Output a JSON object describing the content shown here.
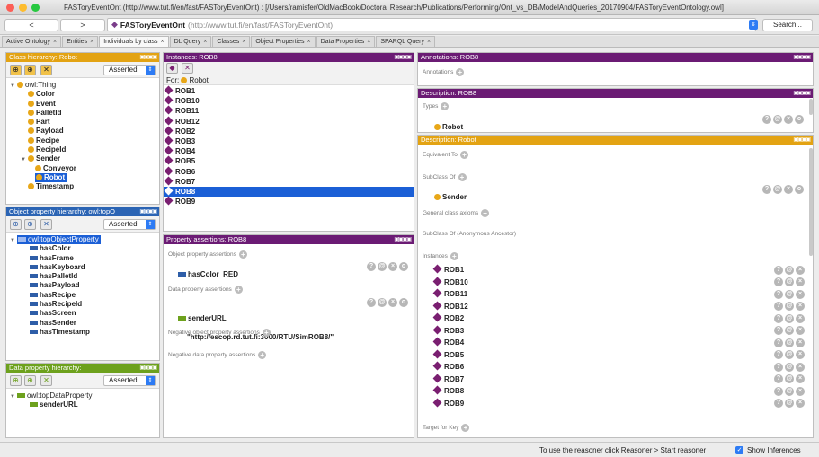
{
  "window": {
    "title": "FASToryEventOnt (http://www.tut.fi/en/fast/FASToryEventOnt) : [/Users/ramisfer/OldMacBook/Doctoral Research/Publications/Performing/Ont_vs_DB/ModelAndQueries_20170904/FASToryEventOntology.owl]"
  },
  "toolbar": {
    "back": "<",
    "forward": ">",
    "ontology_name": "FASToryEventOnt",
    "ontology_uri": "(http://www.tut.fi/en/fast/FASToryEventOnt)",
    "search_label": "Search..."
  },
  "tabs": [
    {
      "label": "Active Ontology"
    },
    {
      "label": "Entities"
    },
    {
      "label": "Individuals by class"
    },
    {
      "label": "DL Query"
    },
    {
      "label": "Classes"
    },
    {
      "label": "Object Properties"
    },
    {
      "label": "Data Properties"
    },
    {
      "label": "SPARQL Query"
    }
  ],
  "class_hierarchy": {
    "title": "Class hierarchy: Robot",
    "mode": "Asserted",
    "root": "owl:Thing",
    "items": [
      "Color",
      "Event",
      "PalletId",
      "Part",
      "Payload",
      "Recipe",
      "RecipeId",
      "Sender",
      "Conveyor",
      "Robot",
      "Timestamp"
    ]
  },
  "object_property_hierarchy": {
    "title": "Object property hierarchy: owl:topO",
    "mode": "Asserted",
    "root": "owl:topObjectProperty",
    "items": [
      "hasColor",
      "hasFrame",
      "hasKeyboard",
      "hasPalletId",
      "hasPayload",
      "hasRecipe",
      "hasRecipeId",
      "hasScreen",
      "hasSender",
      "hasTimestamp"
    ]
  },
  "data_property_hierarchy": {
    "title": "Data property hierarchy:",
    "mode": "Asserted",
    "root": "owl:topDataProperty",
    "items": [
      "senderURL"
    ]
  },
  "instances": {
    "title": "Instances: ROB8",
    "for_label": "For:",
    "for_class": "Robot",
    "items": [
      "ROB1",
      "ROB10",
      "ROB11",
      "ROB12",
      "ROB2",
      "ROB3",
      "ROB4",
      "ROB5",
      "ROB6",
      "ROB7",
      "ROB8",
      "ROB9"
    ],
    "selected": "ROB8"
  },
  "property_assertions": {
    "title": "Property assertions: ROB8",
    "object_label": "Object property assertions",
    "object_prop": "hasColor",
    "object_val": "RED",
    "data_label": "Data property assertions",
    "data_prop": "senderURL",
    "data_val": "\"http://escop.rd.tut.fi:3000/RTU/SimROB8/\"",
    "neg_object_label": "Negative object property assertions",
    "neg_data_label": "Negative data property assertions"
  },
  "annotations": {
    "title": "Annotations: ROB8",
    "label": "Annotations"
  },
  "description_individual": {
    "title": "Description: ROB8",
    "types_label": "Types",
    "type": "Robot"
  },
  "description_class": {
    "title": "Description: Robot",
    "equivalent_label": "Equivalent To",
    "subclass_label": "SubClass Of",
    "subclass": "Sender",
    "general_label": "General class axioms",
    "anon_label": "SubClass Of (Anonymous Ancestor)",
    "instances_label": "Instances",
    "instances": [
      "ROB1",
      "ROB10",
      "ROB11",
      "ROB12",
      "ROB2",
      "ROB3",
      "ROB4",
      "ROB5",
      "ROB6",
      "ROB7",
      "ROB8",
      "ROB9"
    ],
    "target_label": "Target for Key"
  },
  "status": {
    "reasoner_text": "To use the reasoner click Reasoner > Start reasoner",
    "show_inferences": "Show Inferences"
  },
  "colors": {
    "class_header": "#e3a313",
    "individual_header": "#6b1b74",
    "object_property_header": "#2b64b4",
    "data_property_header": "#6da11d",
    "selection": "#1b5fd6"
  }
}
